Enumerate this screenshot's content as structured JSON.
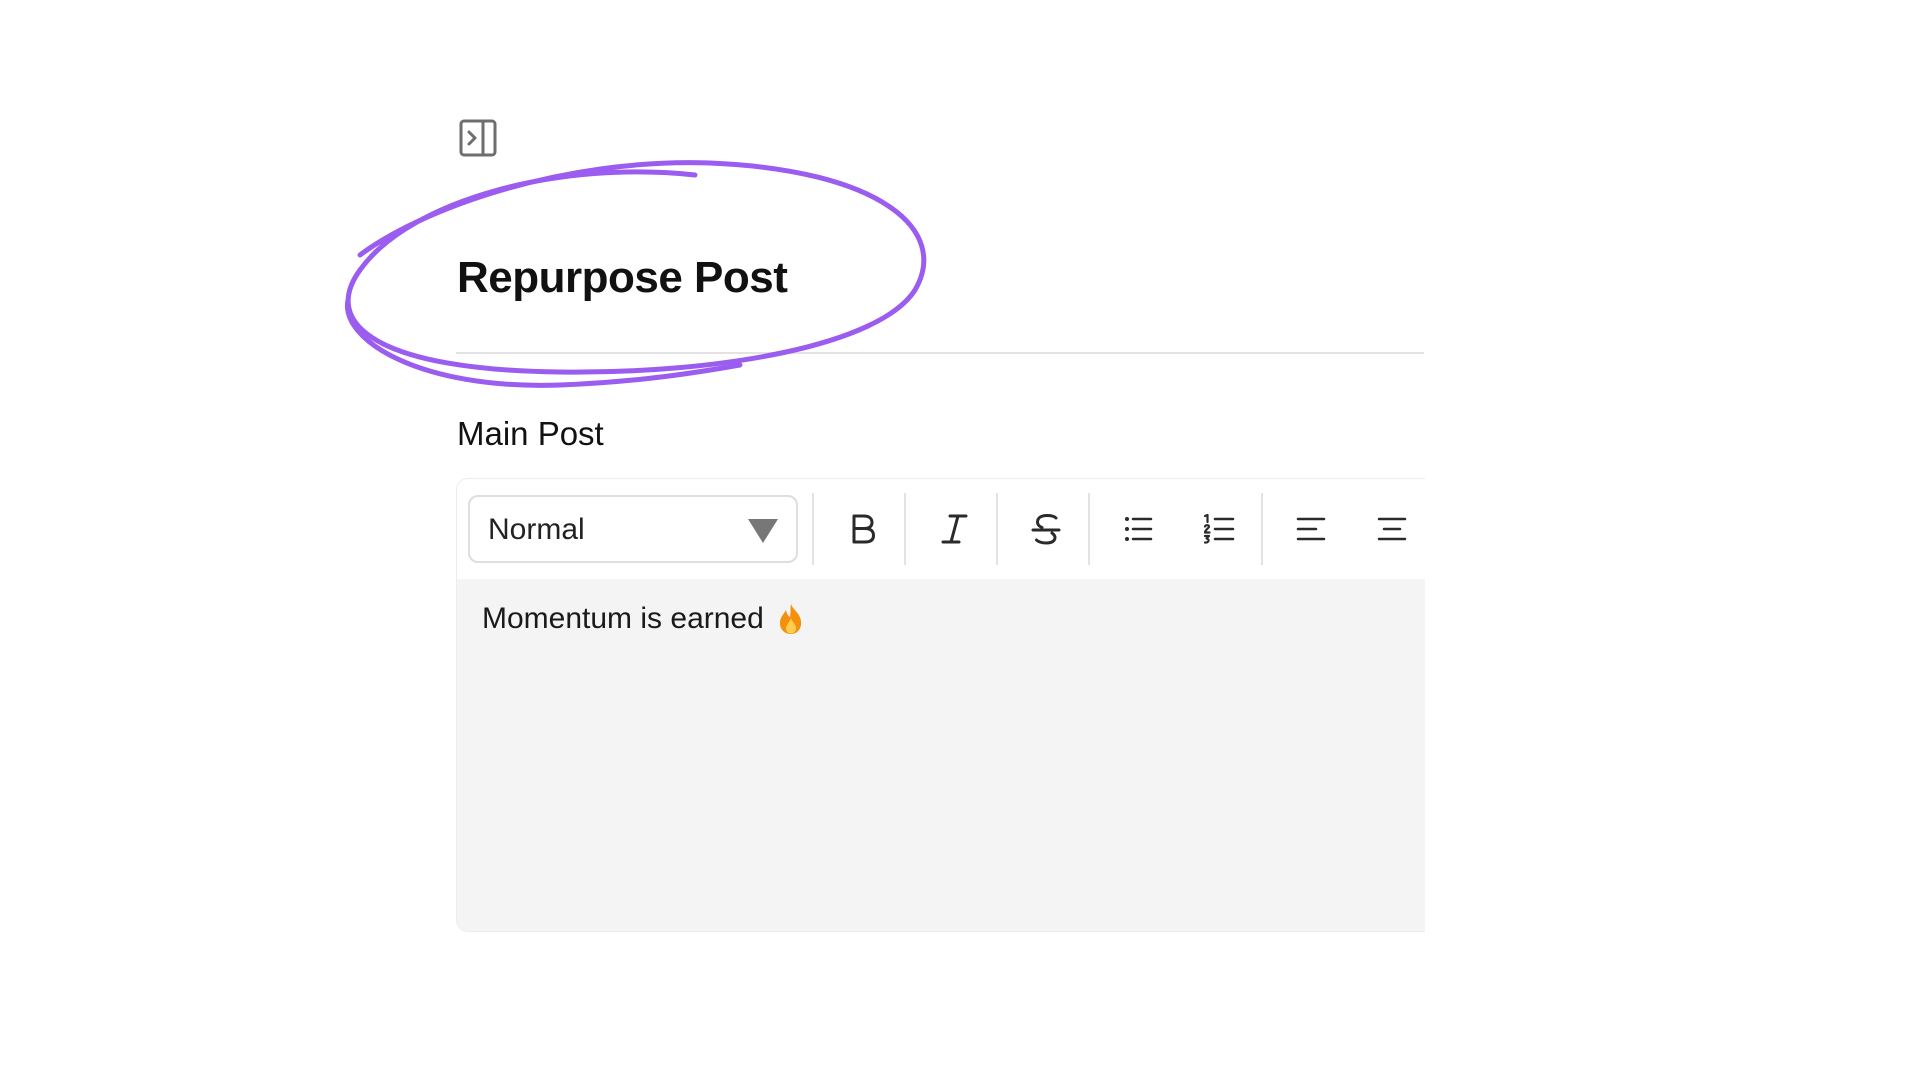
{
  "header": {
    "panel_toggle_icon": "sidebar-expand-icon",
    "title": "Repurpose Post",
    "highlight_color": "#9b5cf0"
  },
  "main_post": {
    "label": "Main Post",
    "toolbar": {
      "format_select": {
        "selected": "Normal"
      },
      "buttons": [
        {
          "name": "bold",
          "icon": "bold-icon"
        },
        {
          "name": "italic",
          "icon": "italic-icon"
        },
        {
          "name": "strikethrough",
          "icon": "strikethrough-icon"
        },
        {
          "name": "bullet-list",
          "icon": "bullet-list-icon"
        },
        {
          "name": "numbered-list",
          "icon": "numbered-list-icon"
        },
        {
          "name": "align-left",
          "icon": "align-left-icon"
        },
        {
          "name": "align-center",
          "icon": "align-center-icon"
        }
      ]
    },
    "content": {
      "text": "Momentum is earned",
      "emoji_icon": "fire-emoji-icon"
    }
  }
}
